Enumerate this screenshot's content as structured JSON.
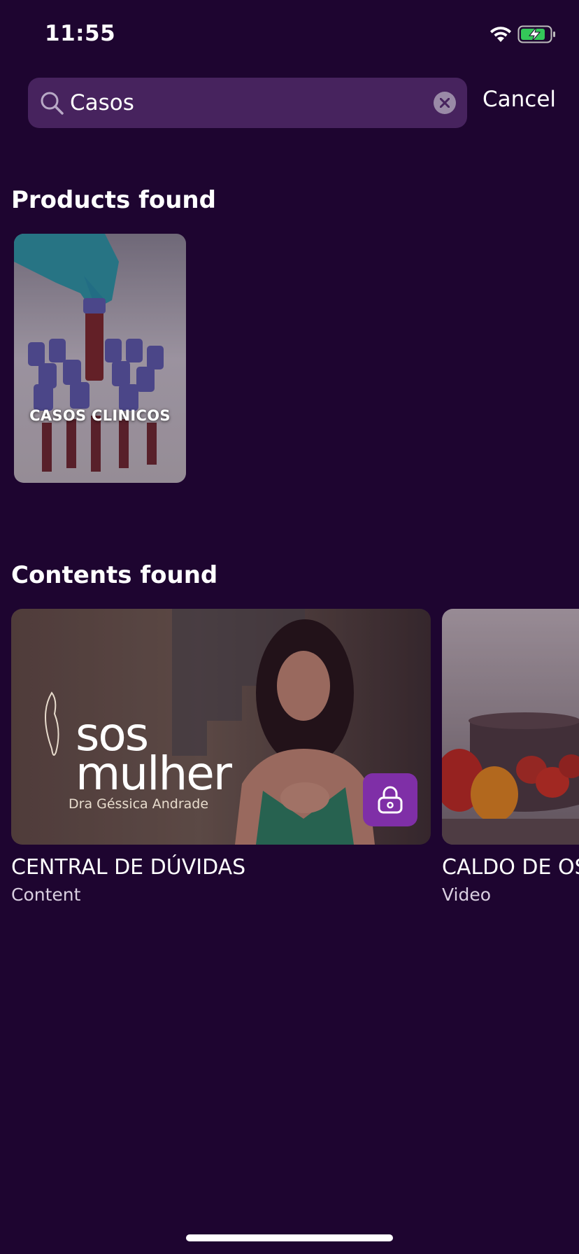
{
  "status_bar": {
    "time": "11:55"
  },
  "search": {
    "value": "Casos",
    "cancel_label": "Cancel"
  },
  "products_section": {
    "title": "Products found",
    "items": [
      {
        "label": "CASOS CLINICOS"
      }
    ]
  },
  "contents_section": {
    "title": "Contents found",
    "items": [
      {
        "title": "CENTRAL DE DÚVIDAS",
        "type": "Content",
        "brand": "sos mulher",
        "brand_line1": "sos",
        "brand_line2": "mulher",
        "brand_subtitle": "Dra Géssica Andrade",
        "locked": true
      },
      {
        "title": "CALDO DE OS",
        "type": "Video"
      }
    ]
  },
  "colors": {
    "background": "#1e0530",
    "search_bg": "#47235e",
    "lock_accent": "#7f2fa7"
  }
}
